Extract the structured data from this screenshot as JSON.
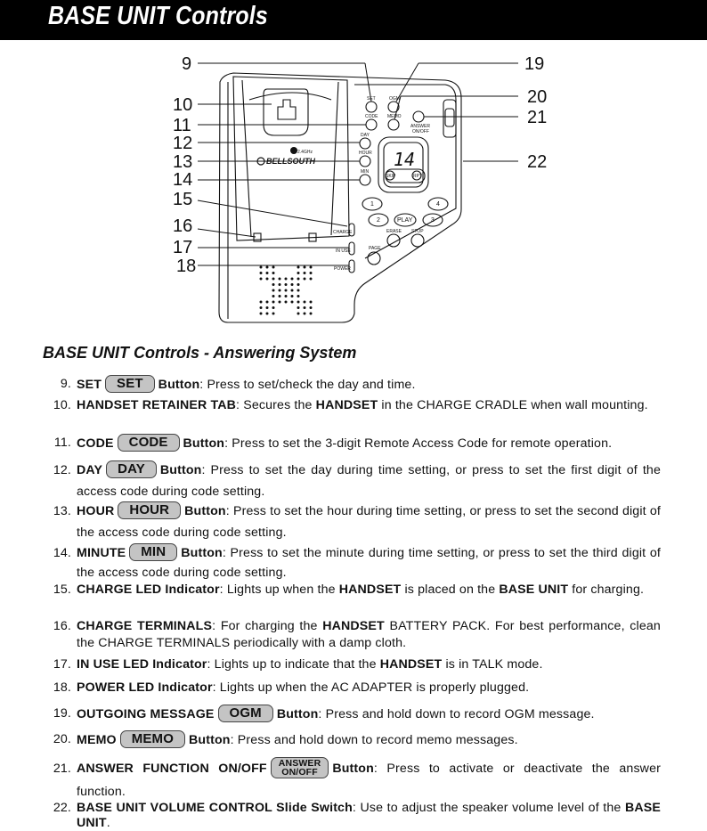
{
  "page": {
    "banner_title": "BASE UNIT Controls",
    "section_heading": "BASE UNIT Controls - Answering System"
  },
  "diagram": {
    "callouts_left": [
      "9",
      "10",
      "11",
      "12",
      "13",
      "14",
      "15",
      "16",
      "17",
      "18"
    ],
    "callouts_right": [
      "19",
      "20",
      "21",
      "22"
    ],
    "device_labels": {
      "set": "SET",
      "ogm": "OGM",
      "code": "CODE",
      "memo": "MEMO",
      "answer": "ANSWER",
      "on_off": "ON/OFF",
      "day": "DAY",
      "hour": "HOUR",
      "min": "MIN",
      "display": "14",
      "skip": "SKIP",
      "rpt": "RPT",
      "key_1": "1",
      "key_2": "2",
      "key_3": "3",
      "key_4": "4",
      "play": "PLAY",
      "erase": "ERASE",
      "stop": "STOP",
      "page": "PAGE",
      "charge": "CHARGE",
      "in_use": "IN USE",
      "power": "POWER",
      "brand": "BELLSOUTH",
      "freq": "2.4GHz"
    }
  },
  "items": [
    {
      "num": "9.",
      "name": "SET",
      "badge": "SET",
      "rest_bold": "Button",
      "rest": ": Press to set/check the day and time."
    },
    {
      "num": "10.",
      "name": "HANDSET RETAINER TAB",
      "rest_a": ": Secures the ",
      "bold_b": "HANDSET",
      "rest_c": " in the CHARGE CRADLE when wall mounting."
    },
    {
      "num": "11.",
      "name": "CODE",
      "badge": "CODE",
      "rest_bold": "Button",
      "rest": ": Press to set the 3-digit Remote Access Code for remote operation."
    },
    {
      "num": "12.",
      "name": "DAY",
      "badge": "DAY",
      "rest_bold": "Button",
      "rest": ": Press to set the day during time setting, or press to set the first digit of the access code during code setting."
    },
    {
      "num": "13.",
      "name": "HOUR",
      "badge": "HOUR",
      "rest_bold": "Button",
      "rest": ": Press to set the hour during time setting, or press to set the second digit of the access code during code setting."
    },
    {
      "num": "14.",
      "name": "MINUTE",
      "badge": "MIN",
      "rest_bold": "Button",
      "rest": ": Press to set the minute during time setting, or press to set the third digit of the access code during code setting."
    },
    {
      "num": "15.",
      "name": "CHARGE LED Indicator",
      "rest_a": ": Lights up when the ",
      "bold_b": "HANDSET",
      "rest_c": " is placed on the ",
      "bold_d": "BASE UNIT",
      "rest_e": " for charging."
    },
    {
      "num": "16.",
      "name": "CHARGE TERMINALS",
      "rest_a": ": For charging the ",
      "bold_b": "HANDSET",
      "rest_c": " BATTERY PACK. For best performance, clean the CHARGE TERMINALS periodically with a damp cloth."
    },
    {
      "num": "17.",
      "name": "IN USE LED Indicator",
      "rest_a": ": Lights up to indicate that the ",
      "bold_b": "HANDSET",
      "rest_c": " is in TALK mode."
    },
    {
      "num": "18.",
      "name": "POWER LED Indicator",
      "rest": ": Lights up when the AC ADAPTER is properly plugged."
    },
    {
      "num": "19.",
      "name": "OUTGOING MESSAGE",
      "badge": "OGM",
      "rest_bold": "Button",
      "rest": ": Press and hold down to record OGM message."
    },
    {
      "num": "20.",
      "name": "MEMO",
      "badge": "MEMO",
      "rest_bold": "Button",
      "rest": ": Press and hold down to record memo messages."
    },
    {
      "num": "21.",
      "name": "ANSWER FUNCTION ON/OFF",
      "badge_line1": "ANSWER",
      "badge_line2": "ON/OFF",
      "rest_bold": "Button",
      "rest": ": Press to activate or deactivate the answer function."
    },
    {
      "num": "22.",
      "name": "BASE UNIT VOLUME CONTROL Slide Switch",
      "rest": ": Use to adjust the speaker volume level of the ",
      "bold_end": "BASE UNIT",
      "end": "."
    }
  ]
}
